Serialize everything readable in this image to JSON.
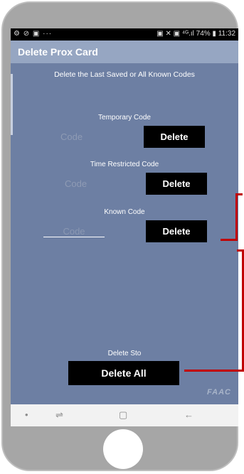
{
  "status_bar": {
    "left_icons": "⚙ ⊘ ▣ ···",
    "right_text": "▣ ✕ ▣ ⁴ᴳ.ıl 74% ▮ 11:32"
  },
  "app_bar": {
    "title": "Delete Prox Card"
  },
  "subtitle": "Delete the Last Saved or All Known Codes",
  "sections": {
    "temporary": {
      "label": "Temporary Code",
      "placeholder": "Code",
      "button": "Delete"
    },
    "time_restricted": {
      "label": "Time Restricted Code",
      "placeholder": "Code",
      "button": "Delete"
    },
    "known": {
      "label": "Known Code",
      "placeholder": "Code",
      "button": "Delete"
    },
    "delete_all": {
      "label": "Delete Sto",
      "button": "Delete All"
    }
  },
  "logo": {
    "text": "FAAC"
  },
  "nav_bar": {
    "dot": "•",
    "recent": "⇌",
    "home": "▢",
    "back": "←"
  },
  "colors": {
    "screen_bg": "#6d7fa3",
    "appbar_bg": "#96a6c2",
    "button_bg": "#000000",
    "annotation": "#c00000"
  }
}
